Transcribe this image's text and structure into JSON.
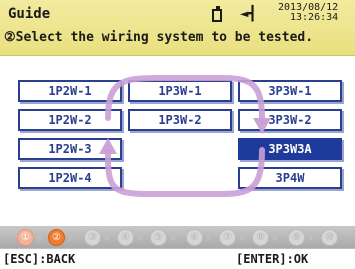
{
  "header": {
    "title": "Guide",
    "date": "2013/08/12",
    "time": "13:26:34",
    "instruction": "②Select the wiring system to be tested."
  },
  "wiring": {
    "left_col": [
      "1P2W-1",
      "1P2W-2",
      "1P2W-3",
      "1P2W-4"
    ],
    "mid_col": [
      "1P3W-1",
      "1P3W-2"
    ],
    "right_col": [
      "3P3W-1",
      "3P3W-2",
      "3P3W3A",
      "3P4W"
    ],
    "selected": "3P3W3A"
  },
  "steps": {
    "labels": [
      "①",
      "②",
      "③",
      "④",
      "⑤",
      "⑥",
      "⑦",
      "⑧",
      "⑨",
      "⑩"
    ],
    "current_index": 1
  },
  "footer": {
    "esc_hint": "[ESC]:BACK",
    "enter_hint": "[ENTER]:OK"
  },
  "colors": {
    "header_bg": "#ece486",
    "button_border": "#2a3f8f",
    "selected_bg": "#1e3a9a",
    "step_current": "#ef7d2c",
    "arrow": "#c9a0d6"
  },
  "icons": {
    "battery": "battery-icon",
    "power": "plug-icon"
  }
}
